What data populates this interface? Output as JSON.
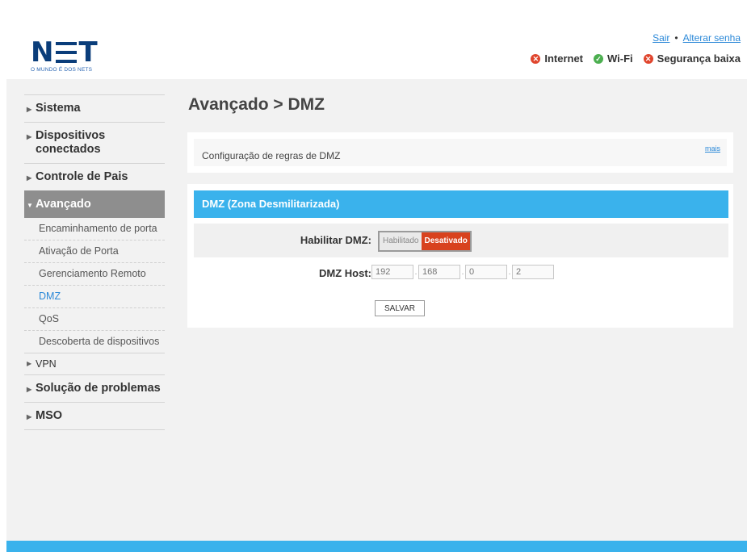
{
  "header": {
    "logo_text": "NET",
    "logo_tagline": "O MUNDO É DOS NETS",
    "links": {
      "logout": "Sair",
      "separator": "•",
      "change_password": "Alterar senha"
    },
    "status": [
      {
        "label": "Internet",
        "state": "error"
      },
      {
        "label": "Wi-Fi",
        "state": "ok"
      },
      {
        "label": "Segurança baixa",
        "state": "error"
      }
    ]
  },
  "sidebar": {
    "items": [
      {
        "label": "Sistema"
      },
      {
        "label": "Dispositivos conectados"
      },
      {
        "label": "Controle de Pais"
      },
      {
        "label": "Avançado",
        "active": true
      }
    ],
    "subitems": [
      {
        "label": "Encaminhamento de porta"
      },
      {
        "label": "Ativação de Porta"
      },
      {
        "label": "Gerenciamento Remoto"
      },
      {
        "label": "DMZ",
        "current": true
      },
      {
        "label": "QoS"
      },
      {
        "label": "Descoberta de dispositivos"
      }
    ],
    "vpn": "VPN",
    "troubleshoot": "Solução de problemas",
    "mso": "MSO"
  },
  "main": {
    "title": "Avançado > DMZ",
    "description": "Configuração de regras de DMZ",
    "more": "mais",
    "section_title": "DMZ (Zona Desmilitarizada)",
    "enable_label": "Habilitar DMZ:",
    "toggle": {
      "enabled": "Habilitado",
      "disabled": "Desativado",
      "selected": "Desativado"
    },
    "host_label": "DMZ Host:",
    "host_ip": [
      "192",
      "168",
      "0",
      "2"
    ],
    "ip_separator": ".",
    "save": "SALVAR"
  },
  "colors": {
    "accent": "#3ab2ec",
    "brand": "#0a3d7a",
    "danger": "#d8421e",
    "ok": "#4caf50",
    "link": "#2a88d8"
  }
}
